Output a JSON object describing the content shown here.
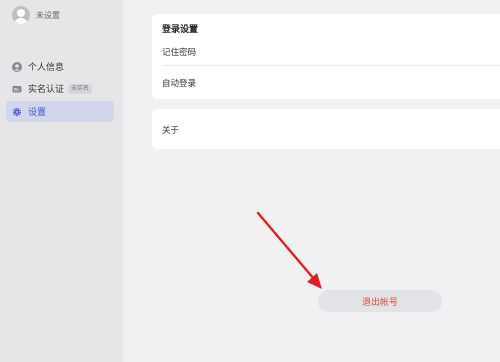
{
  "user": {
    "name": "未设置"
  },
  "sidebar": {
    "items": [
      {
        "label": "个人信息",
        "icon": "person-icon"
      },
      {
        "label": "实名认证",
        "icon": "id-card-icon",
        "badge": "未实名"
      },
      {
        "label": "设置",
        "icon": "gear-icon",
        "active": true
      }
    ]
  },
  "login_settings": {
    "title": "登录设置",
    "remember_password": "记住密码",
    "auto_login": "自动登录"
  },
  "about": {
    "label": "关于"
  },
  "logout": {
    "label": "退出帐号"
  },
  "colors": {
    "accent": "#3b55d6",
    "danger": "#d94a3c",
    "annotation_arrow": "#e02020"
  }
}
